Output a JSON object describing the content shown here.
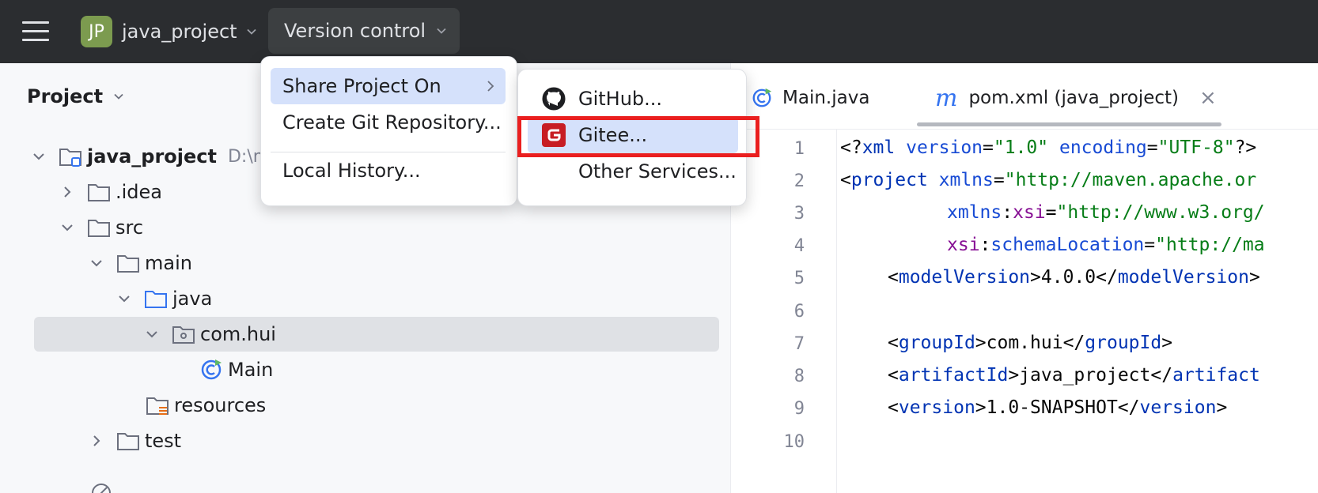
{
  "toolbar": {
    "project_badge": "JP",
    "project_name": "java_project",
    "vcs_label": "Version control"
  },
  "project_panel": {
    "title": "Project",
    "tree": [
      {
        "label": "java_project",
        "hint": "D:\\m",
        "expanded": true,
        "icon": "module-folder-icon"
      },
      {
        "label": ".idea",
        "expanded": false,
        "icon": "folder-icon"
      },
      {
        "label": "src",
        "expanded": true,
        "icon": "folder-icon"
      },
      {
        "label": "main",
        "expanded": true,
        "icon": "folder-icon"
      },
      {
        "label": "java",
        "expanded": true,
        "icon": "source-folder-icon"
      },
      {
        "label": "com.hui",
        "expanded": true,
        "icon": "package-icon",
        "selected": true
      },
      {
        "label": "Main",
        "icon": "java-class-icon"
      },
      {
        "label": "resources",
        "icon": "resources-folder-icon"
      },
      {
        "label": "test",
        "expanded": false,
        "icon": "folder-icon"
      }
    ]
  },
  "editor": {
    "tabs": [
      {
        "label": "Main.java",
        "icon": "java-class-icon"
      },
      {
        "label": "pom.xml (java_project)",
        "icon": "maven-icon",
        "active": true,
        "icon_text": "m"
      }
    ],
    "line_numbers": [
      "1",
      "2",
      "3",
      "4",
      "5",
      "6",
      "7",
      "8",
      "9",
      "10"
    ],
    "lines": {
      "l1": {
        "a": "<?",
        "b": "xml",
        "c": " version",
        "d": "=",
        "e": "\"1.0\"",
        "f": " encoding",
        "g": "=",
        "h": "\"UTF-8\"",
        "i": "?>"
      },
      "l2": {
        "a": "<",
        "b": "project",
        "c": " xmlns",
        "d": "=",
        "e": "\"http://maven.apache.or"
      },
      "l3": {
        "a": "xmlns",
        "b": ":",
        "c": "xsi",
        "d": "=",
        "e": "\"http://www.w3.org/"
      },
      "l4": {
        "a": "xsi",
        "b": ":",
        "c": "schemaLocation",
        "d": "=",
        "e": "\"http://ma"
      },
      "l5": {
        "a": "<",
        "b": "modelVersion",
        "c": ">4.0.0</",
        "d": "modelVersion",
        "e": ">"
      },
      "l7": {
        "a": "<",
        "b": "groupId",
        "c": ">com.hui</",
        "d": "groupId",
        "e": ">"
      },
      "l8": {
        "a": "<",
        "b": "artifactId",
        "c": ">java_project</",
        "d": "artifact"
      },
      "l9": {
        "a": "<",
        "b": "version",
        "c": ">1.0-SNAPSHOT</",
        "d": "version",
        "e": ">"
      }
    }
  },
  "vcs_menu": {
    "items": [
      "Share Project On",
      "Create Git Repository...",
      "Local History..."
    ]
  },
  "share_submenu": {
    "items": [
      "GitHub...",
      "Gitee...",
      "Other Services..."
    ]
  },
  "colors": {
    "highlight": "#d5e1fb",
    "annotation": "#ea1f1f",
    "topbar": "#2b2d30"
  }
}
